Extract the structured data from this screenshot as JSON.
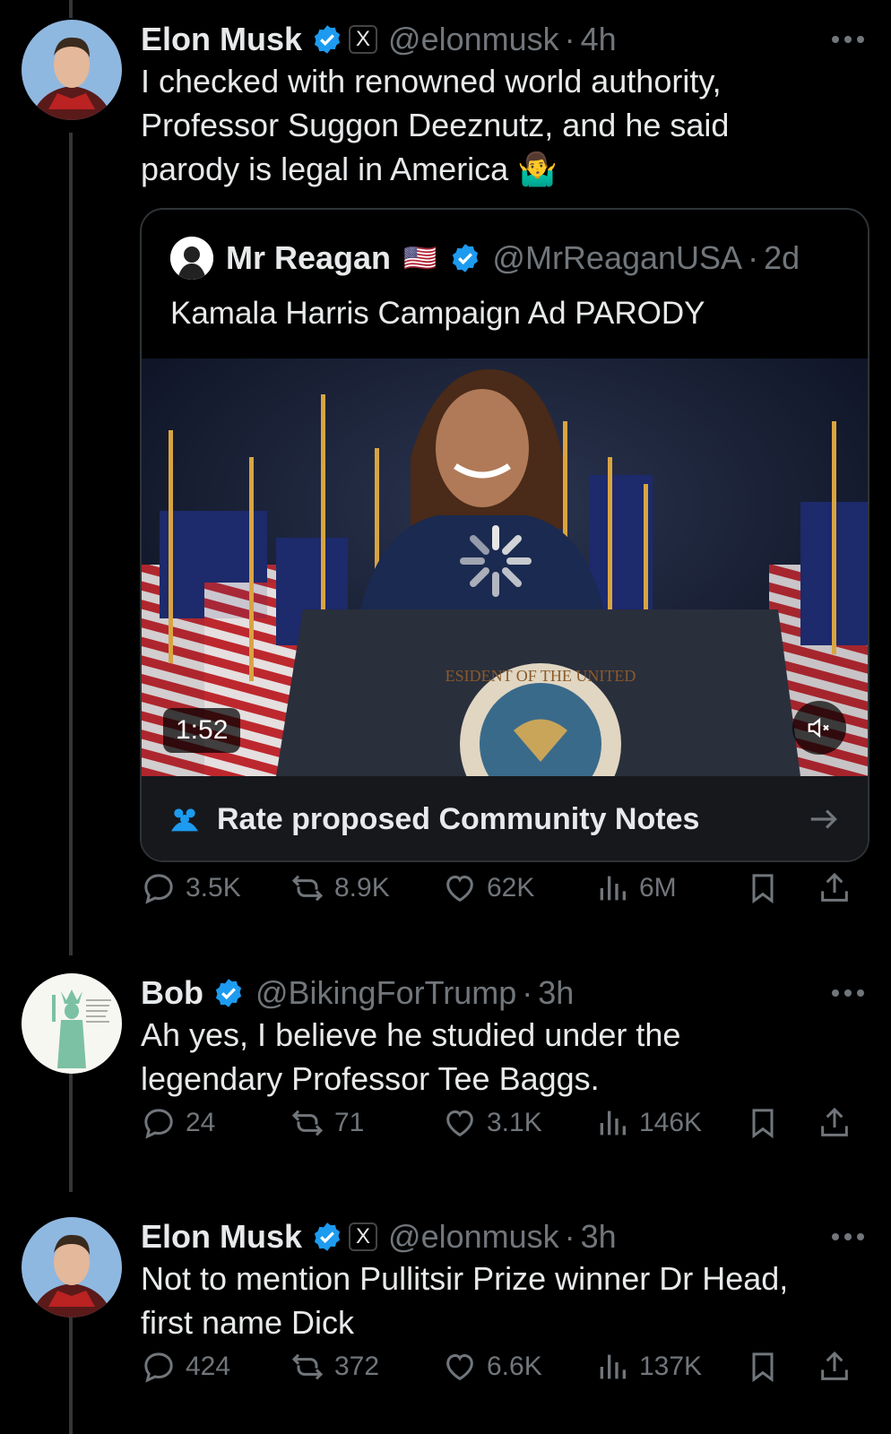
{
  "tweets": [
    {
      "name": "Elon Musk",
      "handle": "@elonmusk",
      "time": "4h",
      "text_lines": [
        "I checked with renowned world authority,",
        "Professor Suggon Deeznutz, and he said",
        "parody is legal in America 🤷‍♂️"
      ],
      "quote": {
        "name": "Mr Reagan",
        "flag": "🇺🇸",
        "handle": "@MrReaganUSA",
        "time": "2d",
        "text": "Kamala Harris Campaign Ad PARODY",
        "duration": "1:52",
        "community_notes": "Rate proposed Community Notes",
        "seal_text": "ESIDENT OF THE UNITED"
      },
      "stats": {
        "replies": "3.5K",
        "reposts": "8.9K",
        "likes": "62K",
        "views": "6M"
      }
    },
    {
      "name": "Bob",
      "handle": "@BikingForTrump",
      "time": "3h",
      "text_lines": [
        "Ah yes, I believe he studied under the",
        "legendary Professor Tee Baggs."
      ],
      "stats": {
        "replies": "24",
        "reposts": "71",
        "likes": "3.1K",
        "views": "146K"
      }
    },
    {
      "name": "Elon Musk",
      "handle": "@elonmusk",
      "time": "3h",
      "text_lines": [
        "Not to mention Pullitsir Prize winner Dr Head,",
        "first name Dick"
      ],
      "stats": {
        "replies": "424",
        "reposts": "372",
        "likes": "6.6K",
        "views": "137K"
      }
    }
  ],
  "icons": {
    "verified": "verified-badge",
    "x_affiliate": "X",
    "reply": "reply-icon",
    "repost": "repost-icon",
    "like": "like-icon",
    "views": "views-icon",
    "bookmark": "bookmark-icon",
    "share": "share-icon"
  },
  "colors": {
    "background": "#000000",
    "text": "#e7e9ea",
    "muted": "#71767b",
    "verified": "#1d9bf0",
    "border": "#2f3336"
  },
  "sep": "·"
}
